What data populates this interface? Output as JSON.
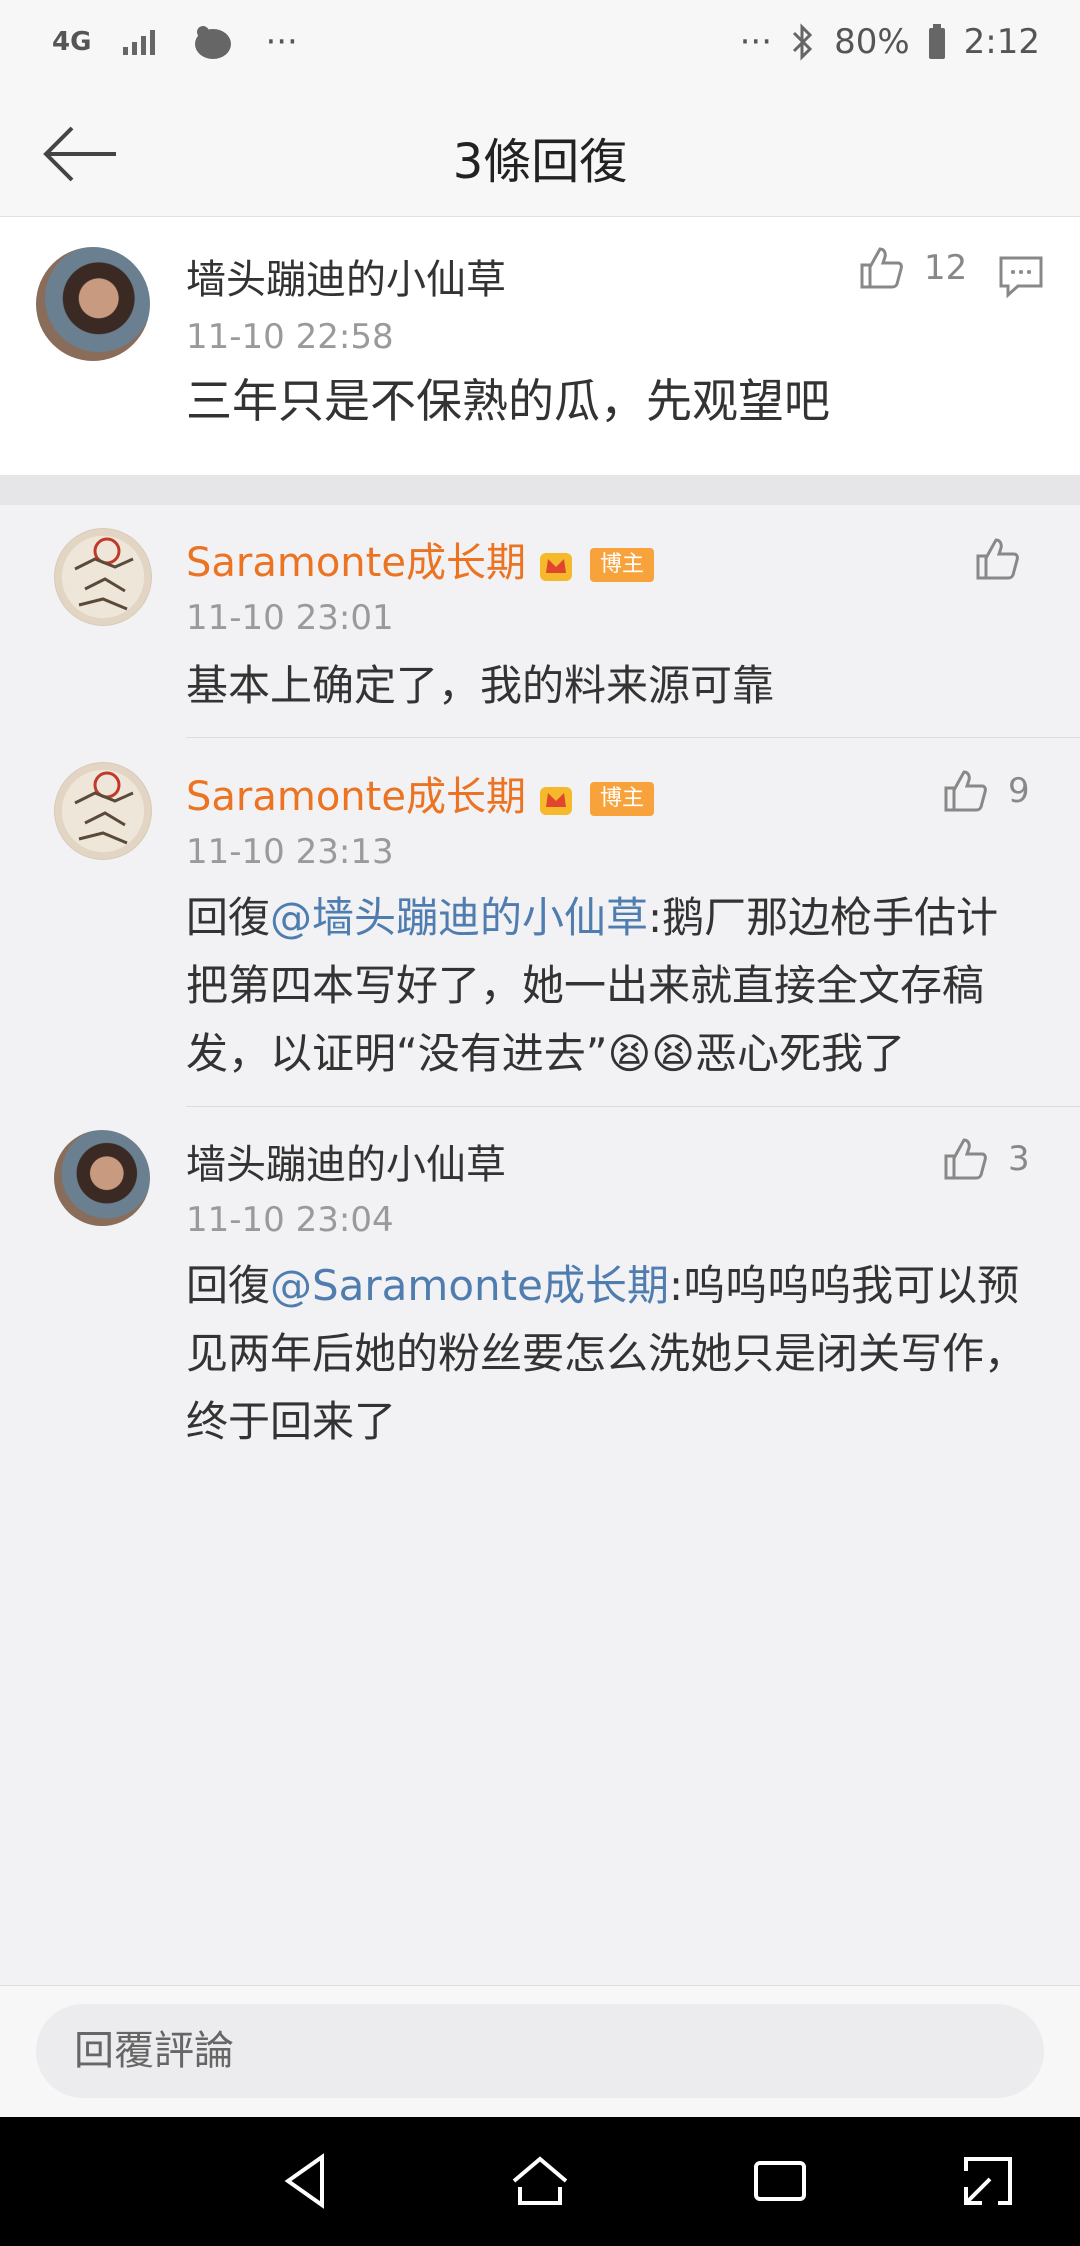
{
  "status_bar": {
    "network": "4G",
    "more_left": "···",
    "more_right": "···",
    "battery": "80%",
    "time": "2:12"
  },
  "header": {
    "title": "3條回復"
  },
  "main_comment": {
    "username": "墙头蹦迪的小仙草",
    "time": "11-10 22:58",
    "text": "三年只是不保熟的瓜，先观望吧",
    "likes": "12"
  },
  "replies": [
    {
      "username": "Saramonte成长期",
      "badge": "博主",
      "time": "11-10 23:01",
      "text": "基本上确定了，我的料来源可靠",
      "likes": ""
    },
    {
      "username": "Saramonte成长期",
      "badge": "博主",
      "time": "11-10 23:13",
      "prefix": "回復",
      "mention": "@墙头蹦迪的小仙草",
      "text_line1": ":鹅厂那边枪手估计",
      "text_line2": "把第四本写好了，她一出来就直接全文存稿",
      "text_line3": "发，以证明“没有进去”😫😫恶心死我了",
      "likes": "9"
    },
    {
      "username": "墙头蹦迪的小仙草",
      "time": "11-10 23:04",
      "prefix": "回復",
      "mention": "@Saramonte成长期",
      "text_line1": ":呜呜呜呜我可以预",
      "text_line2": "见两年后她的粉丝要怎么洗她只是闭关写作，",
      "text_line3": "终于回来了",
      "likes": "3"
    }
  ],
  "reply_input": {
    "placeholder": "回覆評論"
  },
  "colors": {
    "username_orange": "#eb7321",
    "mention_blue": "#507daf",
    "badge_orange": "#f7a23b"
  },
  "icons": [
    "back-arrow-icon",
    "thumbs-up-icon",
    "comment-icon",
    "bluetooth-icon",
    "battery-icon",
    "signal-icon",
    "crown-icon",
    "nav-back-icon",
    "nav-home-icon",
    "nav-recents-icon",
    "nav-expand-icon"
  ]
}
